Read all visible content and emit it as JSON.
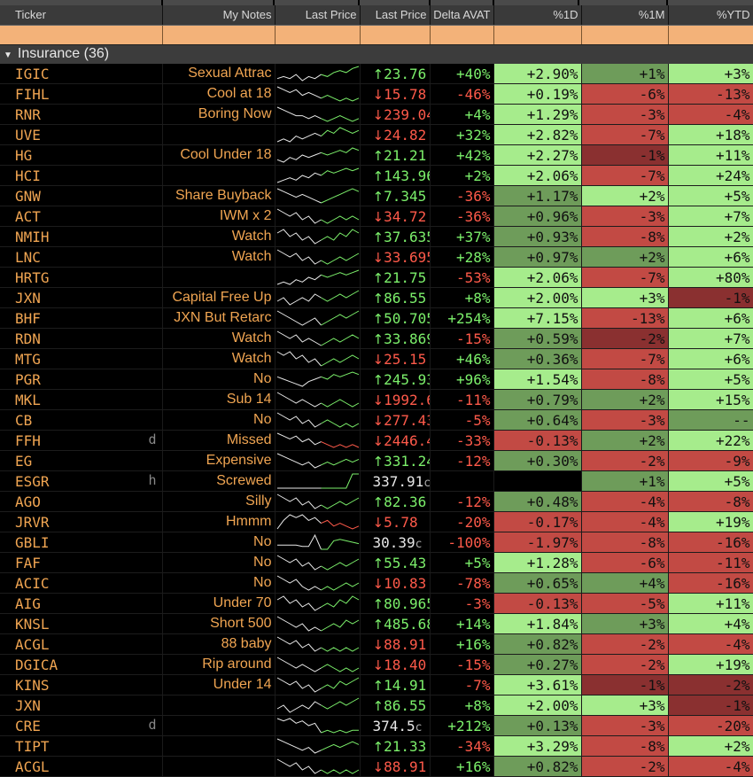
{
  "columns": [
    "Ticker",
    "My Notes",
    "Last Price",
    "Last Price",
    "Delta AVAT",
    "%1D",
    "%1M",
    "%YTD"
  ],
  "group": {
    "label": "Insurance (36)"
  },
  "rows": [
    {
      "t": "IGIC",
      "f": "",
      "n": "Sexual Attrac",
      "a": "↑",
      "p": "23.76",
      "x": "",
      "d": "+40%",
      "d1": "+2.90%",
      "m": "+1%",
      "y": "+3%",
      "c1": "g1",
      "cm": "g2",
      "cy": "g1",
      "s": [
        3,
        4,
        3,
        5,
        2,
        4,
        3,
        5,
        4,
        6,
        7,
        6,
        8,
        9
      ]
    },
    {
      "t": "FIHL",
      "f": "",
      "n": "Cool at 18",
      "a": "↓",
      "p": "15.78",
      "x": "",
      "d": "-46%",
      "d1": "+0.19%",
      "m": "-6%",
      "y": "-13%",
      "c1": "g1",
      "cm": "r1",
      "cy": "r1",
      "s": [
        8,
        7,
        6,
        7,
        5,
        6,
        5,
        4,
        5,
        4,
        3,
        4,
        3,
        4
      ]
    },
    {
      "t": "RNR",
      "f": "",
      "n": "Boring Now",
      "a": "↓",
      "p": "239.04",
      "x": "",
      "d": "+4%",
      "d1": "+1.29%",
      "m": "-3%",
      "y": "-4%",
      "c1": "g1",
      "cm": "r1",
      "cy": "r1",
      "s": [
        9,
        8,
        7,
        6,
        6,
        5,
        6,
        5,
        4,
        5,
        6,
        5,
        4,
        5
      ]
    },
    {
      "t": "UVE",
      "f": "",
      "n": "",
      "a": "↓",
      "p": "24.82",
      "x": "",
      "d": "+32%",
      "d1": "+2.82%",
      "m": "-7%",
      "y": "+18%",
      "c1": "g1",
      "cm": "r1",
      "cy": "g1",
      "s": [
        3,
        4,
        3,
        5,
        4,
        5,
        6,
        5,
        7,
        6,
        8,
        7,
        6,
        7
      ]
    },
    {
      "t": "HG",
      "f": "",
      "n": "Cool Under 18",
      "a": "↑",
      "p": "21.21",
      "x": "",
      "d": "+42%",
      "d1": "+2.27%",
      "m": "-1%",
      "y": "+11%",
      "c1": "g1",
      "cm": "r2",
      "cy": "g1",
      "s": [
        3,
        2,
        4,
        3,
        5,
        4,
        5,
        6,
        5,
        6,
        7,
        6,
        8,
        7
      ]
    },
    {
      "t": "HCI",
      "f": "",
      "n": "",
      "a": "↑",
      "p": "143.96",
      "x": "",
      "d": "+2%",
      "d1": "+2.06%",
      "m": "-7%",
      "y": "+24%",
      "c1": "g1",
      "cm": "r1",
      "cy": "g1",
      "s": [
        2,
        3,
        4,
        3,
        5,
        4,
        6,
        5,
        7,
        6,
        7,
        8,
        7,
        8
      ]
    },
    {
      "t": "GNW",
      "f": "",
      "n": "Share Buyback",
      "a": "↑",
      "p": "7.345",
      "x": "",
      "d": "-36%",
      "d1": "+1.17%",
      "m": "+2%",
      "y": "+5%",
      "c1": "g2",
      "cm": "g1",
      "cy": "g1",
      "s": [
        8,
        7,
        6,
        5,
        6,
        5,
        4,
        3,
        4,
        5,
        6,
        7,
        8,
        7
      ]
    },
    {
      "t": "ACT",
      "f": "",
      "n": "IWM x 2",
      "a": "↓",
      "p": "34.72",
      "x": "",
      "d": "-36%",
      "d1": "+0.96%",
      "m": "-3%",
      "y": "+7%",
      "c1": "g2",
      "cm": "r1",
      "cy": "g1",
      "s": [
        8,
        7,
        6,
        7,
        5,
        6,
        4,
        5,
        4,
        5,
        6,
        5,
        6,
        5
      ]
    },
    {
      "t": "NMIH",
      "f": "",
      "n": "Watch",
      "a": "↑",
      "p": "37.635",
      "x": "",
      "d": "+37%",
      "d1": "+0.93%",
      "m": "-8%",
      "y": "+2%",
      "c1": "g2",
      "cm": "r1",
      "cy": "g1",
      "s": [
        7,
        8,
        6,
        7,
        5,
        6,
        4,
        5,
        6,
        5,
        7,
        6,
        8,
        7
      ]
    },
    {
      "t": "LNC",
      "f": "",
      "n": "Watch",
      "a": "↓",
      "p": "33.695",
      "x": "",
      "d": "+28%",
      "d1": "+0.97%",
      "m": "+2%",
      "y": "+6%",
      "c1": "g2",
      "cm": "g2",
      "cy": "g1",
      "s": [
        8,
        7,
        6,
        7,
        5,
        6,
        4,
        5,
        4,
        5,
        6,
        5,
        6,
        7
      ]
    },
    {
      "t": "HRTG",
      "f": "",
      "n": "",
      "a": "↑",
      "p": "21.75",
      "x": "",
      "d": "-53%",
      "d1": "+2.06%",
      "m": "-7%",
      "y": "+80%",
      "c1": "g1",
      "cm": "r1",
      "cy": "g1",
      "s": [
        2,
        3,
        2,
        4,
        3,
        5,
        4,
        6,
        5,
        6,
        7,
        6,
        7,
        8
      ]
    },
    {
      "t": "JXN",
      "f": "",
      "n": "Capital Free Up",
      "a": "↑",
      "p": "86.55",
      "x": "",
      "d": "+8%",
      "d1": "+2.00%",
      "m": "+3%",
      "y": "-1%",
      "c1": "g1",
      "cm": "g1",
      "cy": "r2",
      "s": [
        5,
        6,
        4,
        5,
        6,
        5,
        7,
        6,
        5,
        6,
        7,
        6,
        7,
        8
      ]
    },
    {
      "t": "BHF",
      "f": "",
      "n": "JXN But Retarc",
      "a": "↑",
      "p": "50.705",
      "x": "",
      "d": "+254%",
      "d1": "+7.15%",
      "m": "-13%",
      "y": "+6%",
      "c1": "g1",
      "cm": "r1",
      "cy": "g1",
      "s": [
        8,
        7,
        6,
        5,
        4,
        5,
        6,
        4,
        5,
        6,
        7,
        6,
        7,
        8
      ]
    },
    {
      "t": "RDN",
      "f": "",
      "n": "Watch",
      "a": "↑",
      "p": "33.869",
      "x": "",
      "d": "-15%",
      "d1": "+0.59%",
      "m": "-2%",
      "y": "+7%",
      "c1": "g2",
      "cm": "r2",
      "cy": "g1",
      "s": [
        8,
        7,
        6,
        7,
        5,
        6,
        5,
        4,
        5,
        6,
        5,
        6,
        7,
        6
      ]
    },
    {
      "t": "MTG",
      "f": "",
      "n": "Watch",
      "a": "↓",
      "p": "25.15",
      "x": "",
      "d": "+46%",
      "d1": "+0.36%",
      "m": "-7%",
      "y": "+6%",
      "c1": "g2",
      "cm": "r1",
      "cy": "g1",
      "s": [
        8,
        7,
        8,
        6,
        7,
        5,
        6,
        4,
        5,
        6,
        5,
        6,
        7,
        6
      ]
    },
    {
      "t": "PGR",
      "f": "",
      "n": "No",
      "a": "↑",
      "p": "245.935",
      "x": "",
      "d": "+96%",
      "d1": "+1.54%",
      "m": "-8%",
      "y": "+5%",
      "c1": "g1",
      "cm": "r1",
      "cy": "g1",
      "s": [
        7,
        6,
        5,
        4,
        3,
        5,
        6,
        7,
        6,
        8,
        7,
        8,
        9,
        8
      ]
    },
    {
      "t": "MKL",
      "f": "",
      "n": "Sub 14",
      "a": "↓",
      "p": "1992.62",
      "x": "",
      "d": "-11%",
      "d1": "+0.79%",
      "m": "+2%",
      "y": "+15%",
      "c1": "g2",
      "cm": "g2",
      "cy": "g1",
      "s": [
        8,
        7,
        6,
        5,
        6,
        5,
        4,
        5,
        4,
        5,
        6,
        5,
        4,
        5
      ]
    },
    {
      "t": "CB",
      "f": "",
      "n": "No",
      "a": "↓",
      "p": "277.435",
      "x": "",
      "d": "-5%",
      "d1": "+0.64%",
      "m": "-3%",
      "y": "--",
      "c1": "g2",
      "cm": "r1",
      "cy": "g2",
      "s": [
        8,
        7,
        6,
        7,
        5,
        6,
        4,
        5,
        6,
        5,
        4,
        5,
        4,
        5
      ]
    },
    {
      "t": "FFH",
      "f": "d",
      "n": "Missed",
      "a": "↓",
      "p": "2446.41",
      "x": "",
      "d": "-33%",
      "d1": "-0.13%",
      "m": "+2%",
      "y": "+22%",
      "c1": "r1",
      "cm": "g2",
      "cy": "g1",
      "s": [
        8,
        7,
        6,
        7,
        5,
        6,
        4,
        5,
        4,
        3,
        4,
        3,
        4,
        3
      ]
    },
    {
      "t": "EG",
      "f": "",
      "n": "Expensive",
      "a": "↑",
      "p": "331.245",
      "x": "",
      "d": "-12%",
      "d1": "+0.30%",
      "m": "-2%",
      "y": "-9%",
      "c1": "g2",
      "cm": "r1",
      "cy": "r1",
      "s": [
        8,
        7,
        6,
        5,
        4,
        5,
        3,
        4,
        5,
        4,
        5,
        6,
        5,
        6
      ]
    },
    {
      "t": "ESGR",
      "f": "h",
      "n": "Screwed",
      "a": "",
      "p": "337.91",
      "x": "c",
      "d": "",
      "d1": "",
      "m": "+1%",
      "y": "+5%",
      "c1": "blk",
      "cm": "g2",
      "cy": "g1",
      "s": [
        2,
        2,
        2,
        2,
        2,
        2,
        2,
        2,
        2,
        2,
        2,
        2,
        8,
        8
      ]
    },
    {
      "t": "AGO",
      "f": "",
      "n": "Silly",
      "a": "↑",
      "p": "82.36",
      "x": "",
      "d": "-12%",
      "d1": "+0.48%",
      "m": "-4%",
      "y": "-8%",
      "c1": "g2",
      "cm": "r1",
      "cy": "r1",
      "s": [
        8,
        7,
        6,
        7,
        5,
        6,
        4,
        5,
        4,
        5,
        6,
        5,
        6,
        7
      ]
    },
    {
      "t": "JRVR",
      "f": "",
      "n": "Hmmm",
      "a": "↓",
      "p": "5.78",
      "x": "",
      "d": "-20%",
      "d1": "-0.17%",
      "m": "-4%",
      "y": "+19%",
      "c1": "r1",
      "cm": "r1",
      "cy": "g1",
      "s": [
        3,
        6,
        8,
        7,
        8,
        6,
        7,
        5,
        6,
        4,
        5,
        4,
        3,
        4
      ]
    },
    {
      "t": "GBLI",
      "f": "",
      "n": "No",
      "a": "",
      "p": "30.39",
      "x": "c",
      "d": "-100%",
      "d1": "-1.97%",
      "m": "-8%",
      "y": "-16%",
      "c1": "r1",
      "cm": "r1",
      "cy": "r1",
      "s": [
        3,
        3,
        3,
        3,
        2,
        2,
        10,
        0,
        0,
        6,
        7,
        6,
        5,
        4
      ]
    },
    {
      "t": "FAF",
      "f": "",
      "n": "No",
      "a": "↑",
      "p": "55.43",
      "x": "",
      "d": "+5%",
      "d1": "+1.28%",
      "m": "-6%",
      "y": "-11%",
      "c1": "g1",
      "cm": "r1",
      "cy": "r1",
      "s": [
        8,
        7,
        6,
        7,
        5,
        6,
        4,
        5,
        4,
        5,
        6,
        5,
        6,
        7
      ]
    },
    {
      "t": "ACIC",
      "f": "",
      "n": "No",
      "a": "↓",
      "p": "10.83",
      "x": "",
      "d": "-78%",
      "d1": "+0.65%",
      "m": "+4%",
      "y": "-16%",
      "c1": "g2",
      "cm": "g2",
      "cy": "r1",
      "s": [
        8,
        7,
        6,
        7,
        5,
        4,
        5,
        4,
        5,
        4,
        5,
        6,
        5,
        6
      ]
    },
    {
      "t": "AIG",
      "f": "",
      "n": "Under 70",
      "a": "↑",
      "p": "80.965",
      "x": "",
      "d": "-3%",
      "d1": "-0.13%",
      "m": "-5%",
      "y": "+11%",
      "c1": "r1",
      "cm": "r1",
      "cy": "g1",
      "s": [
        7,
        8,
        6,
        7,
        5,
        6,
        4,
        5,
        6,
        5,
        7,
        6,
        8,
        7
      ]
    },
    {
      "t": "KNSL",
      "f": "",
      "n": "Short 500",
      "a": "↑",
      "p": "485.685",
      "x": "",
      "d": "+14%",
      "d1": "+1.84%",
      "m": "+3%",
      "y": "+4%",
      "c1": "g1",
      "cm": "g2",
      "cy": "g1",
      "s": [
        8,
        7,
        6,
        5,
        6,
        4,
        5,
        4,
        5,
        6,
        5,
        7,
        6,
        7
      ]
    },
    {
      "t": "ACGL",
      "f": "",
      "n": "88 baby",
      "a": "↓",
      "p": "88.91",
      "x": "",
      "d": "+16%",
      "d1": "+0.82%",
      "m": "-2%",
      "y": "-4%",
      "c1": "g2",
      "cm": "r1",
      "cy": "r1",
      "s": [
        8,
        7,
        6,
        7,
        5,
        6,
        4,
        5,
        4,
        5,
        4,
        5,
        4,
        5
      ]
    },
    {
      "t": "DGICA",
      "f": "",
      "n": "Rip around",
      "a": "↓",
      "p": "18.40",
      "x": "",
      "d": "-15%",
      "d1": "+0.27%",
      "m": "-2%",
      "y": "+19%",
      "c1": "g2",
      "cm": "r1",
      "cy": "g1",
      "s": [
        8,
        7,
        6,
        5,
        6,
        5,
        4,
        5,
        6,
        5,
        4,
        5,
        4,
        5
      ]
    },
    {
      "t": "KINS",
      "f": "",
      "n": "Under 14",
      "a": "↑",
      "p": "14.91",
      "x": "",
      "d": "-7%",
      "d1": "+3.61%",
      "m": "-1%",
      "y": "-2%",
      "c1": "g1",
      "cm": "r2",
      "cy": "r2",
      "s": [
        8,
        7,
        6,
        7,
        5,
        6,
        4,
        5,
        6,
        5,
        7,
        6,
        7,
        8
      ]
    },
    {
      "t": "JXN",
      "f": "",
      "n": "",
      "a": "↑",
      "p": "86.55",
      "x": "",
      "d": "+8%",
      "d1": "+2.00%",
      "m": "+3%",
      "y": "-1%",
      "c1": "g1",
      "cm": "g1",
      "cy": "r2",
      "s": [
        5,
        6,
        4,
        5,
        6,
        5,
        7,
        6,
        5,
        6,
        7,
        6,
        7,
        8
      ]
    },
    {
      "t": "CRE",
      "f": "d",
      "n": "",
      "a": "",
      "p": "374.5",
      "x": "c",
      "d": "+212%",
      "d1": "+0.13%",
      "m": "-3%",
      "y": "-20%",
      "c1": "g2",
      "cm": "r1",
      "cy": "r1",
      "s": [
        8,
        7,
        8,
        6,
        7,
        5,
        6,
        2,
        3,
        2,
        3,
        2,
        3,
        3
      ]
    },
    {
      "t": "TIPT",
      "f": "",
      "n": "",
      "a": "↑",
      "p": "21.33",
      "x": "",
      "d": "-34%",
      "d1": "+3.29%",
      "m": "-8%",
      "y": "+2%",
      "c1": "g1",
      "cm": "r1",
      "cy": "g1",
      "s": [
        8,
        7,
        6,
        5,
        4,
        5,
        3,
        4,
        5,
        6,
        5,
        6,
        7,
        6
      ]
    },
    {
      "t": "ACGL",
      "f": "",
      "n": "",
      "a": "↓",
      "p": "88.91",
      "x": "",
      "d": "+16%",
      "d1": "+0.82%",
      "m": "-2%",
      "y": "-4%",
      "c1": "g2",
      "cm": "r1",
      "cy": "r1",
      "s": [
        8,
        7,
        6,
        7,
        5,
        6,
        4,
        5,
        4,
        5,
        4,
        5,
        4,
        5
      ]
    }
  ]
}
